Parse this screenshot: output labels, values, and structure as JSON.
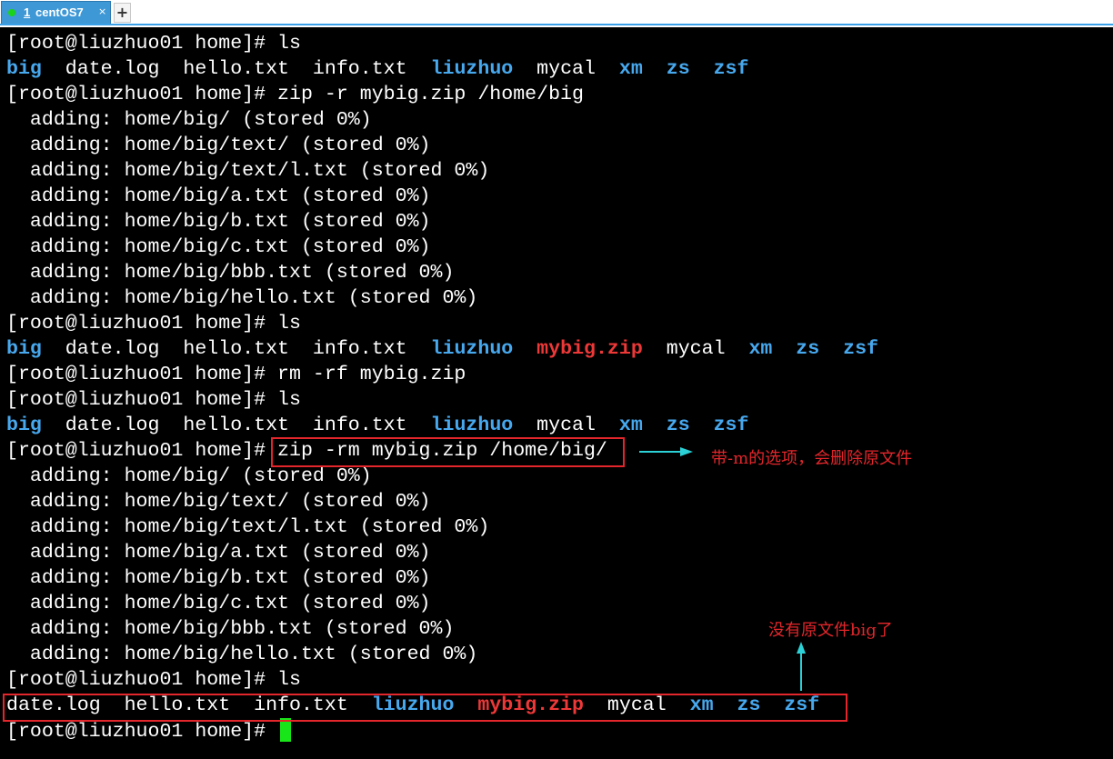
{
  "tab": {
    "number": "1",
    "title": "centOS7",
    "close_glyph": "×",
    "add_glyph": "+",
    "status_color": "#19d419"
  },
  "colors": {
    "background": "#000000",
    "text": "#ffffff",
    "directory": "#47a8ee",
    "archive": "#ee3838",
    "annotation": "#e3262b",
    "arrow": "#2bd1d6",
    "cursor": "#19e619"
  },
  "terminal": {
    "lines": [
      [
        {
          "t": "[root@liuzhuo01 home]# ls"
        }
      ],
      [
        {
          "t": "big",
          "c": "dir"
        },
        {
          "t": "  date.log  hello.txt  info.txt  "
        },
        {
          "t": "liuzhuo",
          "c": "dir"
        },
        {
          "t": "  mycal  "
        },
        {
          "t": "xm",
          "c": "dir"
        },
        {
          "t": "  "
        },
        {
          "t": "zs",
          "c": "dir"
        },
        {
          "t": "  "
        },
        {
          "t": "zsf",
          "c": "dir"
        }
      ],
      [
        {
          "t": "[root@liuzhuo01 home]# zip -r mybig.zip /home/big"
        }
      ],
      [
        {
          "t": "  adding: home/big/ (stored 0%)"
        }
      ],
      [
        {
          "t": "  adding: home/big/text/ (stored 0%)"
        }
      ],
      [
        {
          "t": "  adding: home/big/text/l.txt (stored 0%)"
        }
      ],
      [
        {
          "t": "  adding: home/big/a.txt (stored 0%)"
        }
      ],
      [
        {
          "t": "  adding: home/big/b.txt (stored 0%)"
        }
      ],
      [
        {
          "t": "  adding: home/big/c.txt (stored 0%)"
        }
      ],
      [
        {
          "t": "  adding: home/big/bbb.txt (stored 0%)"
        }
      ],
      [
        {
          "t": "  adding: home/big/hello.txt (stored 0%)"
        }
      ],
      [
        {
          "t": "[root@liuzhuo01 home]# ls"
        }
      ],
      [
        {
          "t": "big",
          "c": "dir"
        },
        {
          "t": "  date.log  hello.txt  info.txt  "
        },
        {
          "t": "liuzhuo",
          "c": "dir"
        },
        {
          "t": "  "
        },
        {
          "t": "mybig.zip",
          "c": "zip"
        },
        {
          "t": "  mycal  "
        },
        {
          "t": "xm",
          "c": "dir"
        },
        {
          "t": "  "
        },
        {
          "t": "zs",
          "c": "dir"
        },
        {
          "t": "  "
        },
        {
          "t": "zsf",
          "c": "dir"
        }
      ],
      [
        {
          "t": "[root@liuzhuo01 home]# rm -rf mybig.zip"
        }
      ],
      [
        {
          "t": "[root@liuzhuo01 home]# ls"
        }
      ],
      [
        {
          "t": "big",
          "c": "dir"
        },
        {
          "t": "  date.log  hello.txt  info.txt  "
        },
        {
          "t": "liuzhuo",
          "c": "dir"
        },
        {
          "t": "  mycal  "
        },
        {
          "t": "xm",
          "c": "dir"
        },
        {
          "t": "  "
        },
        {
          "t": "zs",
          "c": "dir"
        },
        {
          "t": "  "
        },
        {
          "t": "zsf",
          "c": "dir"
        }
      ],
      [
        {
          "t": "[root@liuzhuo01 home]# zip -rm mybig.zip /home/big/"
        }
      ],
      [
        {
          "t": "  adding: home/big/ (stored 0%)"
        }
      ],
      [
        {
          "t": "  adding: home/big/text/ (stored 0%)"
        }
      ],
      [
        {
          "t": "  adding: home/big/text/l.txt (stored 0%)"
        }
      ],
      [
        {
          "t": "  adding: home/big/a.txt (stored 0%)"
        }
      ],
      [
        {
          "t": "  adding: home/big/b.txt (stored 0%)"
        }
      ],
      [
        {
          "t": "  adding: home/big/c.txt (stored 0%)"
        }
      ],
      [
        {
          "t": "  adding: home/big/bbb.txt (stored 0%)"
        }
      ],
      [
        {
          "t": "  adding: home/big/hello.txt (stored 0%)"
        }
      ],
      [
        {
          "t": "[root@liuzhuo01 home]# ls"
        }
      ],
      [
        {
          "t": "date.log  hello.txt  info.txt  "
        },
        {
          "t": "liuzhuo",
          "c": "dir"
        },
        {
          "t": "  "
        },
        {
          "t": "mybig.zip",
          "c": "zip"
        },
        {
          "t": "  mycal  "
        },
        {
          "t": "xm",
          "c": "dir"
        },
        {
          "t": "  "
        },
        {
          "t": "zs",
          "c": "dir"
        },
        {
          "t": "  "
        },
        {
          "t": "zsf",
          "c": "dir"
        }
      ],
      [
        {
          "t": "[root@liuzhuo01 home]# "
        }
      ]
    ]
  },
  "annotations": {
    "note1": "带-m的选项，会删除原文件",
    "note2": "没有原文件big了"
  }
}
